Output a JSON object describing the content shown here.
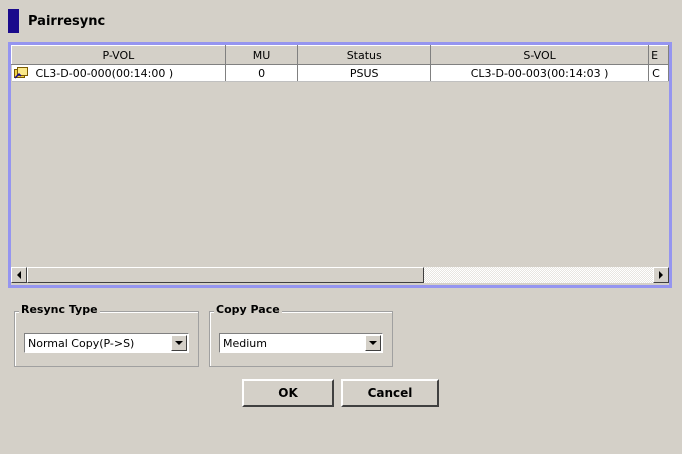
{
  "dialog": {
    "title": "Pairresync"
  },
  "table": {
    "columns": [
      "P-VOL",
      "MU",
      "Status",
      "S-VOL",
      "E"
    ],
    "rows": [
      {
        "icon": "pair-volume-icon",
        "p_vol": "CL3-D-00-000(00:14:00 )",
        "mu": "0",
        "status": "PSUS",
        "s_vol": "CL3-D-00-003(00:14:03 )",
        "e": "C"
      }
    ]
  },
  "resync_type": {
    "label": "Resync Type",
    "selected": "Normal Copy(P->S)"
  },
  "copy_pace": {
    "label": "Copy Pace",
    "selected": "Medium"
  },
  "buttons": {
    "ok": "OK",
    "cancel": "Cancel"
  },
  "colors": {
    "background": "#d4d0c8",
    "title_marker": "#1a0a8c",
    "table_frame": "#9595f0"
  }
}
